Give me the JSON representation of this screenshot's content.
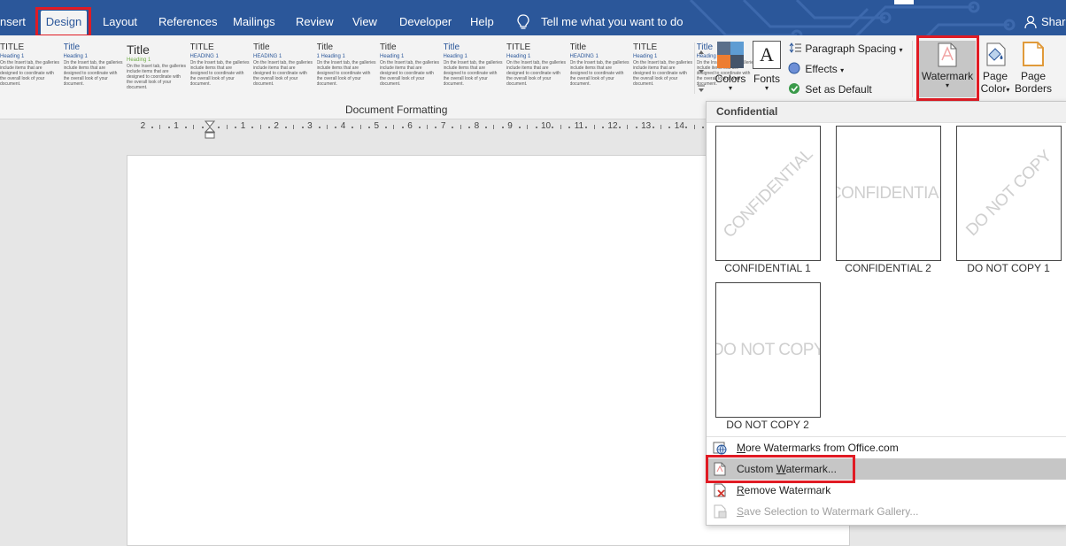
{
  "tabs": [
    {
      "label": "nsert",
      "active": false
    },
    {
      "label": "Design",
      "active": true
    },
    {
      "label": "Layout",
      "active": false
    },
    {
      "label": "References",
      "active": false
    },
    {
      "label": "Mailings",
      "active": false
    },
    {
      "label": "Review",
      "active": false
    },
    {
      "label": "View",
      "active": false
    },
    {
      "label": "Developer",
      "active": false
    },
    {
      "label": "Help",
      "active": false
    }
  ],
  "tell_me": "Tell me what you want to do",
  "share_label": "Share",
  "gallery": [
    {
      "title": "TITLE",
      "heading": "Heading 1"
    },
    {
      "title": "Title",
      "heading": "Heading 1"
    },
    {
      "title": "Title",
      "heading": "Heading 1"
    },
    {
      "title": "TITLE",
      "heading": "HEADING 1"
    },
    {
      "title": "Title",
      "heading": "HEADING 1"
    },
    {
      "title": "Title",
      "heading": "1  Heading 1"
    },
    {
      "title": "Title",
      "heading": "Heading 1"
    },
    {
      "title": "Title",
      "heading": "Heading 1"
    },
    {
      "title": "TITLE",
      "heading": "Heading 1"
    },
    {
      "title": "Title",
      "heading": "HEADING 1"
    },
    {
      "title": "TITLE",
      "heading": "Heading 1"
    },
    {
      "title": "Title",
      "heading": "Heading 1"
    }
  ],
  "gallery_body": "On the Insert tab, the galleries include items that are designed to coordinate with the overall look of your document.",
  "ribbon": {
    "colors_label": "Colors",
    "fonts_label": "Fonts",
    "fonts_glyph": "A",
    "paragraph_spacing": "Paragraph Spacing",
    "effects": "Effects",
    "set_default": "Set as Default",
    "watermark_label": "Watermark",
    "page_color_l1": "Page",
    "page_color_l2": "Color",
    "page_borders_l1": "Page",
    "page_borders_l2": "Borders",
    "document_formatting": "Document Formatting"
  },
  "ruler_numbers": [
    "2",
    "1",
    "",
    "1",
    "2",
    "3",
    "4",
    "5",
    "6",
    "7",
    "8",
    "9",
    "10",
    "11",
    "12",
    "13",
    "14"
  ],
  "dropdown": {
    "header": "Confidential",
    "thumbnails": [
      {
        "text": "CONFIDENTIAL",
        "label": "CONFIDENTIAL 1",
        "diagonal": true
      },
      {
        "text": "CONFIDENTIAL",
        "label": "CONFIDENTIAL 2",
        "diagonal": false
      },
      {
        "text": "DO NOT COPY",
        "label": "DO NOT COPY 1",
        "diagonal": true
      },
      {
        "text": "DO NOT COPY",
        "label": "DO NOT COPY 2",
        "diagonal": false
      }
    ],
    "menu": [
      {
        "label": "More Watermarks from Office.com",
        "accel": "M",
        "rest": "ore Watermarks from Office.com",
        "icon": "globe-icon",
        "disabled": false,
        "highlighted": false
      },
      {
        "label": "Custom Watermark...",
        "accel": "",
        "rest": "Custom ",
        "accel2": "W",
        "rest2": "atermark...",
        "icon": "document-icon",
        "disabled": false,
        "highlighted": true
      },
      {
        "label": "Remove Watermark",
        "accel": "R",
        "rest": "emove Watermark",
        "icon": "remove-watermark-icon",
        "disabled": false,
        "highlighted": false
      },
      {
        "label": "Save Selection to Watermark Gallery...",
        "accel": "S",
        "rest": "ave Selection to Watermark Gallery...",
        "icon": "save-gallery-icon",
        "disabled": true,
        "highlighted": false
      }
    ]
  },
  "colors": {
    "ribbon_blue": "#2b579a",
    "highlight_red": "#e01b24",
    "menu_highlight": "#c6c6c6"
  }
}
